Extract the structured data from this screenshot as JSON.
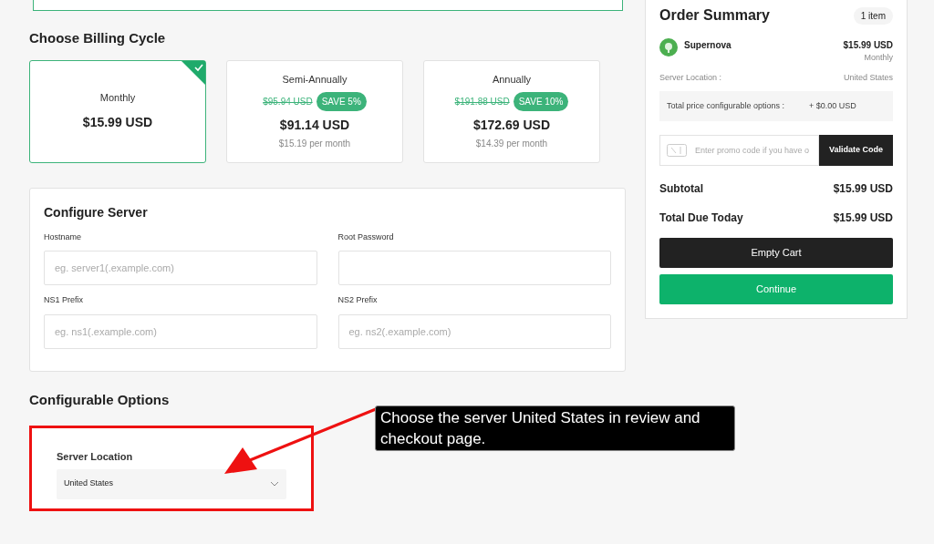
{
  "billing": {
    "title": "Choose Billing Cycle",
    "cycles": [
      {
        "label": "Monthly",
        "price": "$15.99 USD",
        "selected": true
      },
      {
        "label": "Semi-Annually",
        "old_price": "$95.94 USD",
        "save": "SAVE 5%",
        "price": "$91.14 USD",
        "per_month": "$15.19 per month",
        "selected": false
      },
      {
        "label": "Annually",
        "old_price": "$191.88 USD",
        "save": "SAVE 10%",
        "price": "$172.69 USD",
        "per_month": "$14.39 per month",
        "selected": false
      }
    ]
  },
  "server": {
    "title": "Configure Server",
    "fields": [
      {
        "label": "Hostname",
        "placeholder": "eg. server1(.example.com)"
      },
      {
        "label": "Root Password"
      },
      {
        "label": "NS1 Prefix",
        "placeholder": "eg. ns1(.example.com)"
      },
      {
        "label": "NS2 Prefix",
        "placeholder": "eg. ns2(.example.com)"
      }
    ]
  },
  "options": {
    "title": "Configurable Options",
    "label": "Server Location",
    "value": "United States"
  },
  "callout": "Choose the server United States in review and checkout page.",
  "summary": {
    "title": "Order Summary",
    "count": "1 item",
    "product": "Supernova",
    "product_price": "$15.99 USD",
    "cycle": "Monthly",
    "location_label": "Server Location :",
    "location": "United States",
    "options_label": "Total price configurable options :",
    "options_price": "+ $0.00 USD",
    "promo_placeholder": "Enter promo code if you have o",
    "validate": "Validate Code",
    "subtotal_label": "Subtotal",
    "subtotal": "$15.99 USD",
    "total_label": "Total Due Today",
    "total": "$15.99 USD",
    "empty": "Empty Cart",
    "continue": "Continue"
  }
}
